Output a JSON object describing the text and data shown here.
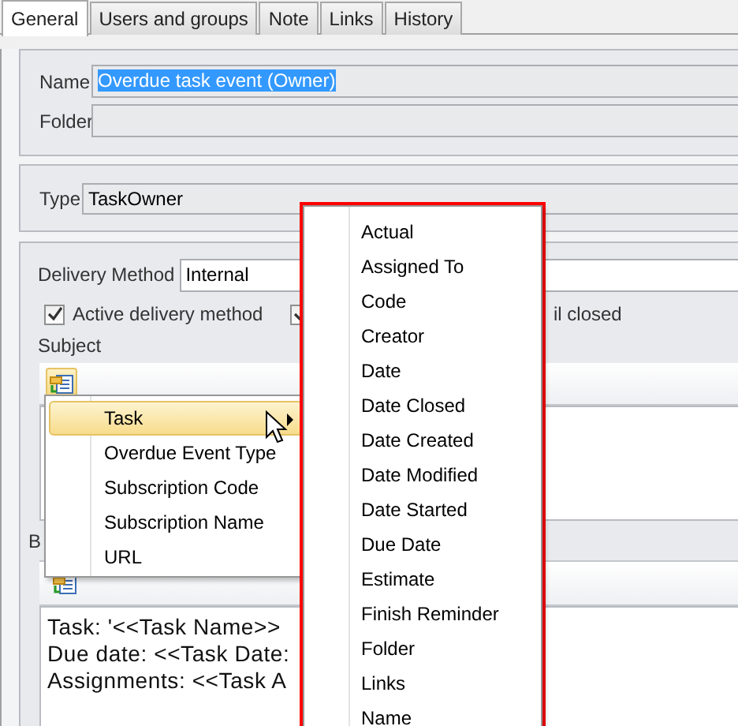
{
  "tabs": [
    {
      "label": "General",
      "selected": true
    },
    {
      "label": "Users and groups",
      "selected": false
    },
    {
      "label": "Note",
      "selected": false
    },
    {
      "label": "Links",
      "selected": false
    },
    {
      "label": "History",
      "selected": false
    }
  ],
  "name_field": {
    "label": "Name",
    "value": "Overdue task event (Owner)",
    "text_selected": true
  },
  "folder_field": {
    "label": "Folder"
  },
  "type_field": {
    "label": "Type",
    "value": "TaskOwner"
  },
  "delivery_method": {
    "label": "Delivery Method",
    "value": "Internal"
  },
  "checkboxes": [
    {
      "label": "Active delivery method",
      "checked": true
    },
    {
      "label": "il closed",
      "checked": true
    }
  ],
  "subject": {
    "label": "Subject",
    "insert_button_hovered": true
  },
  "body": {
    "label": "B",
    "insert_button_hovered": false,
    "lines": [
      "Task: '<<Task Name>>",
      "Due date: <<Task Date:",
      "Assignments: <<Task A"
    ]
  },
  "context_menu": {
    "items": [
      {
        "label": "Task",
        "selected": true,
        "submenu": true
      },
      {
        "label": "Overdue Event Type",
        "selected": false,
        "submenu": false
      },
      {
        "label": "Subscription Code",
        "selected": false,
        "submenu": false
      },
      {
        "label": "Subscription Name",
        "selected": false,
        "submenu": false
      },
      {
        "label": "URL",
        "selected": false,
        "submenu": false
      }
    ]
  },
  "submenu": {
    "highlighted_frame": true,
    "items": [
      "Actual",
      "Assigned To",
      "Code",
      "Creator",
      "Date",
      "Date Closed",
      "Date Created",
      "Date Modified",
      "Date Started",
      "Due Date",
      "Estimate",
      "Finish Reminder",
      "Folder",
      "Links",
      "Name"
    ]
  }
}
